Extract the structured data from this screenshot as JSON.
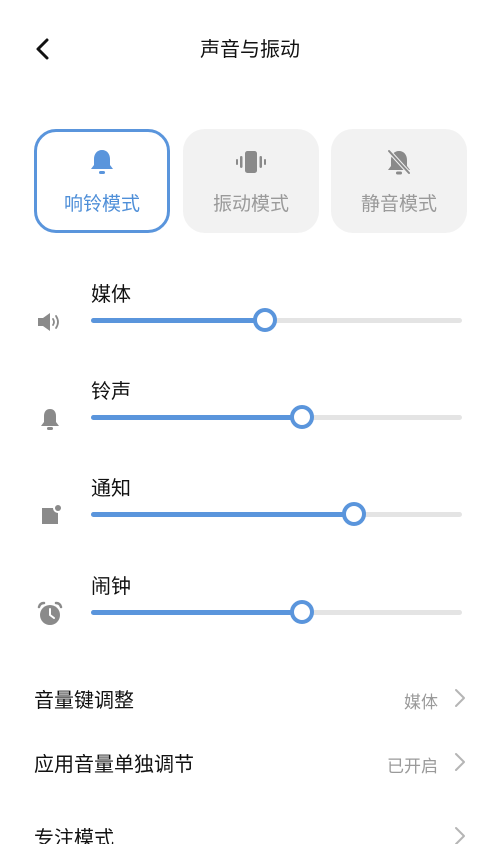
{
  "header": {
    "title": "声音与振动"
  },
  "modes": [
    {
      "label": "响铃模式",
      "icon": "bell-icon",
      "active": true
    },
    {
      "label": "振动模式",
      "icon": "vibrate-icon",
      "active": false
    },
    {
      "label": "静音模式",
      "icon": "bell-off-icon",
      "active": false
    }
  ],
  "volumes": [
    {
      "label": "媒体",
      "icon": "speaker-icon",
      "level": 0.47
    },
    {
      "label": "铃声",
      "icon": "bell-icon",
      "level": 0.57
    },
    {
      "label": "通知",
      "icon": "notification-icon",
      "level": 0.71
    },
    {
      "label": "闹钟",
      "icon": "alarm-clock-icon",
      "level": 0.57
    }
  ],
  "settings": [
    {
      "label": "音量键调整",
      "value": "媒体"
    },
    {
      "label": "应用音量单独调节",
      "value": "已开启"
    },
    {
      "label": "专注模式",
      "value": ""
    }
  ],
  "colors": {
    "accent": "#5a95dc",
    "accent_text": "#4f8fd8",
    "track": "#e4e4e4",
    "card_bg": "#f2f2f2",
    "muted_text": "#9a9a9a",
    "icon_gray": "#8a8a8a"
  }
}
